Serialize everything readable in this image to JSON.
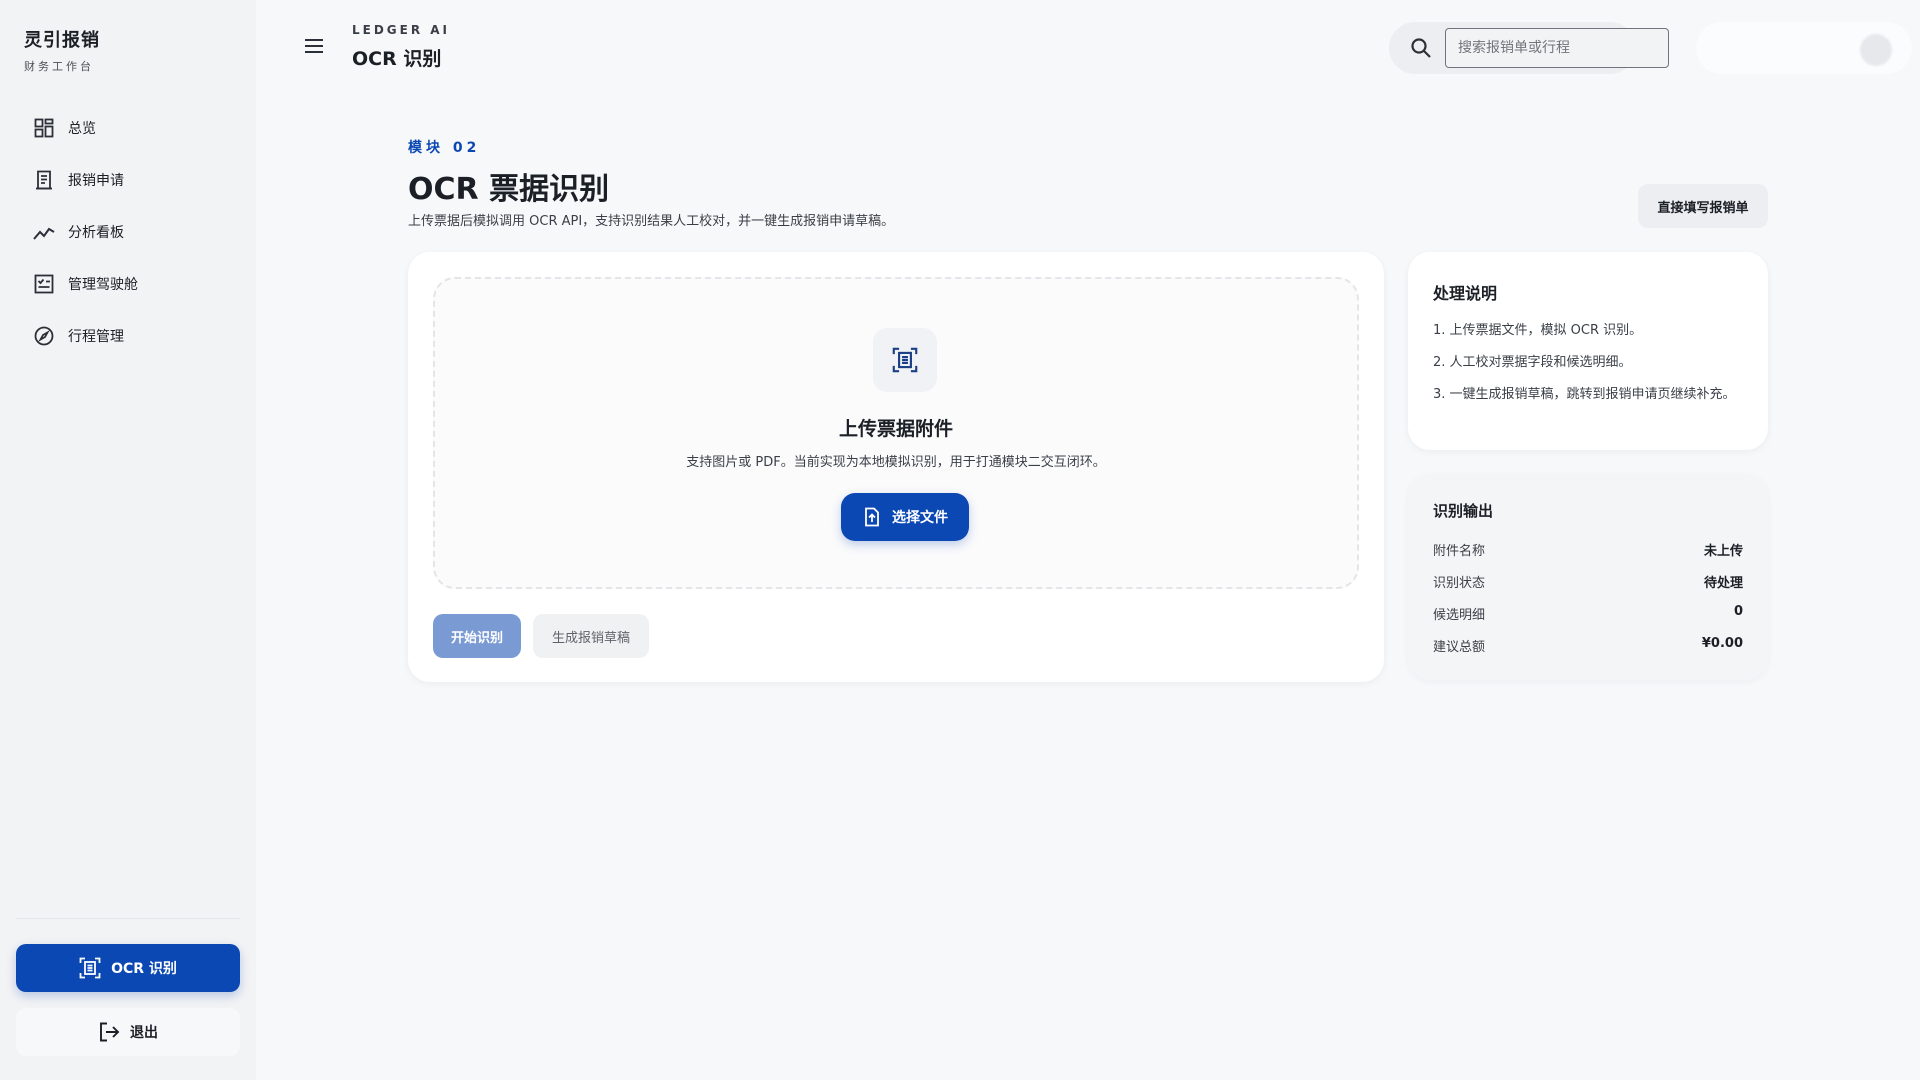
{
  "sidebar": {
    "brand_title": "灵引报销",
    "brand_subtitle": "财务工作台",
    "items": [
      {
        "label": "总览",
        "icon": "dashboard-icon"
      },
      {
        "label": "报销申请",
        "icon": "receipt-icon"
      },
      {
        "label": "分析看板",
        "icon": "trend-chart-icon"
      },
      {
        "label": "管理驾驶舱",
        "icon": "checklist-icon"
      },
      {
        "label": "行程管理",
        "icon": "compass-icon"
      }
    ],
    "ocr_button_label": "OCR 识别",
    "logout_label": "退出"
  },
  "header": {
    "eyebrow": "LEDGER AI",
    "title": "OCR 识别",
    "search_placeholder": "搜索报销单或行程"
  },
  "main": {
    "eyebrow": "模块 02",
    "title": "OCR 票据识别",
    "description": "上传票据后模拟调用 OCR API，支持识别结果人工校对，并一键生成报销申请草稿。",
    "fill_button": "直接填写报销单",
    "upload": {
      "title": "上传票据附件",
      "description": "支持图片或 PDF。当前实现为本地模拟识别，用于打通模块二交互闭环。",
      "choose_button": "选择文件",
      "start_button": "开始识别",
      "draft_button": "生成报销草稿"
    },
    "instructions": {
      "title": "处理说明",
      "steps": [
        "1. 上传票据文件，模拟 OCR 识别。",
        "2. 人工校对票据字段和候选明细。",
        "3. 一键生成报销草稿，跳转到报销申请页继续补充。"
      ]
    },
    "output": {
      "title": "识别输出",
      "rows": [
        {
          "key": "附件名称",
          "value": "未上传"
        },
        {
          "key": "识别状态",
          "value": "待处理"
        },
        {
          "key": "候选明细",
          "value": "0"
        },
        {
          "key": "建议总额",
          "value": "¥0.00"
        }
      ]
    }
  },
  "colors": {
    "primary": "#0b48b3",
    "primary_disabled": "#7a9ad3",
    "background": "#f7f8fa",
    "sidebar_bg": "#f2f3f5"
  }
}
